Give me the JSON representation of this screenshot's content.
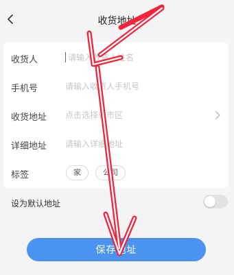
{
  "header": {
    "title": "收货地址",
    "back_icon": "chevron-left-icon"
  },
  "form": {
    "recipient": {
      "label": "收货人",
      "placeholder": "请输入收货人姓名"
    },
    "phone": {
      "label": "手机号",
      "placeholder": "请输入收货人手机号"
    },
    "region": {
      "label": "收货地址",
      "placeholder": "点击选择省市区",
      "icon": "chevron-right-icon"
    },
    "detail": {
      "label": "详细地址",
      "placeholder": "请输入详细地址"
    },
    "tags": {
      "label": "标签",
      "options": [
        "家",
        "公司"
      ]
    }
  },
  "default_address": {
    "label": "设为默认地址",
    "enabled": false
  },
  "footer": {
    "save_label": "保存地址"
  },
  "colors": {
    "accent": "#4a93f0",
    "annotation": "#f0243a",
    "background": "#f4f4f6"
  }
}
